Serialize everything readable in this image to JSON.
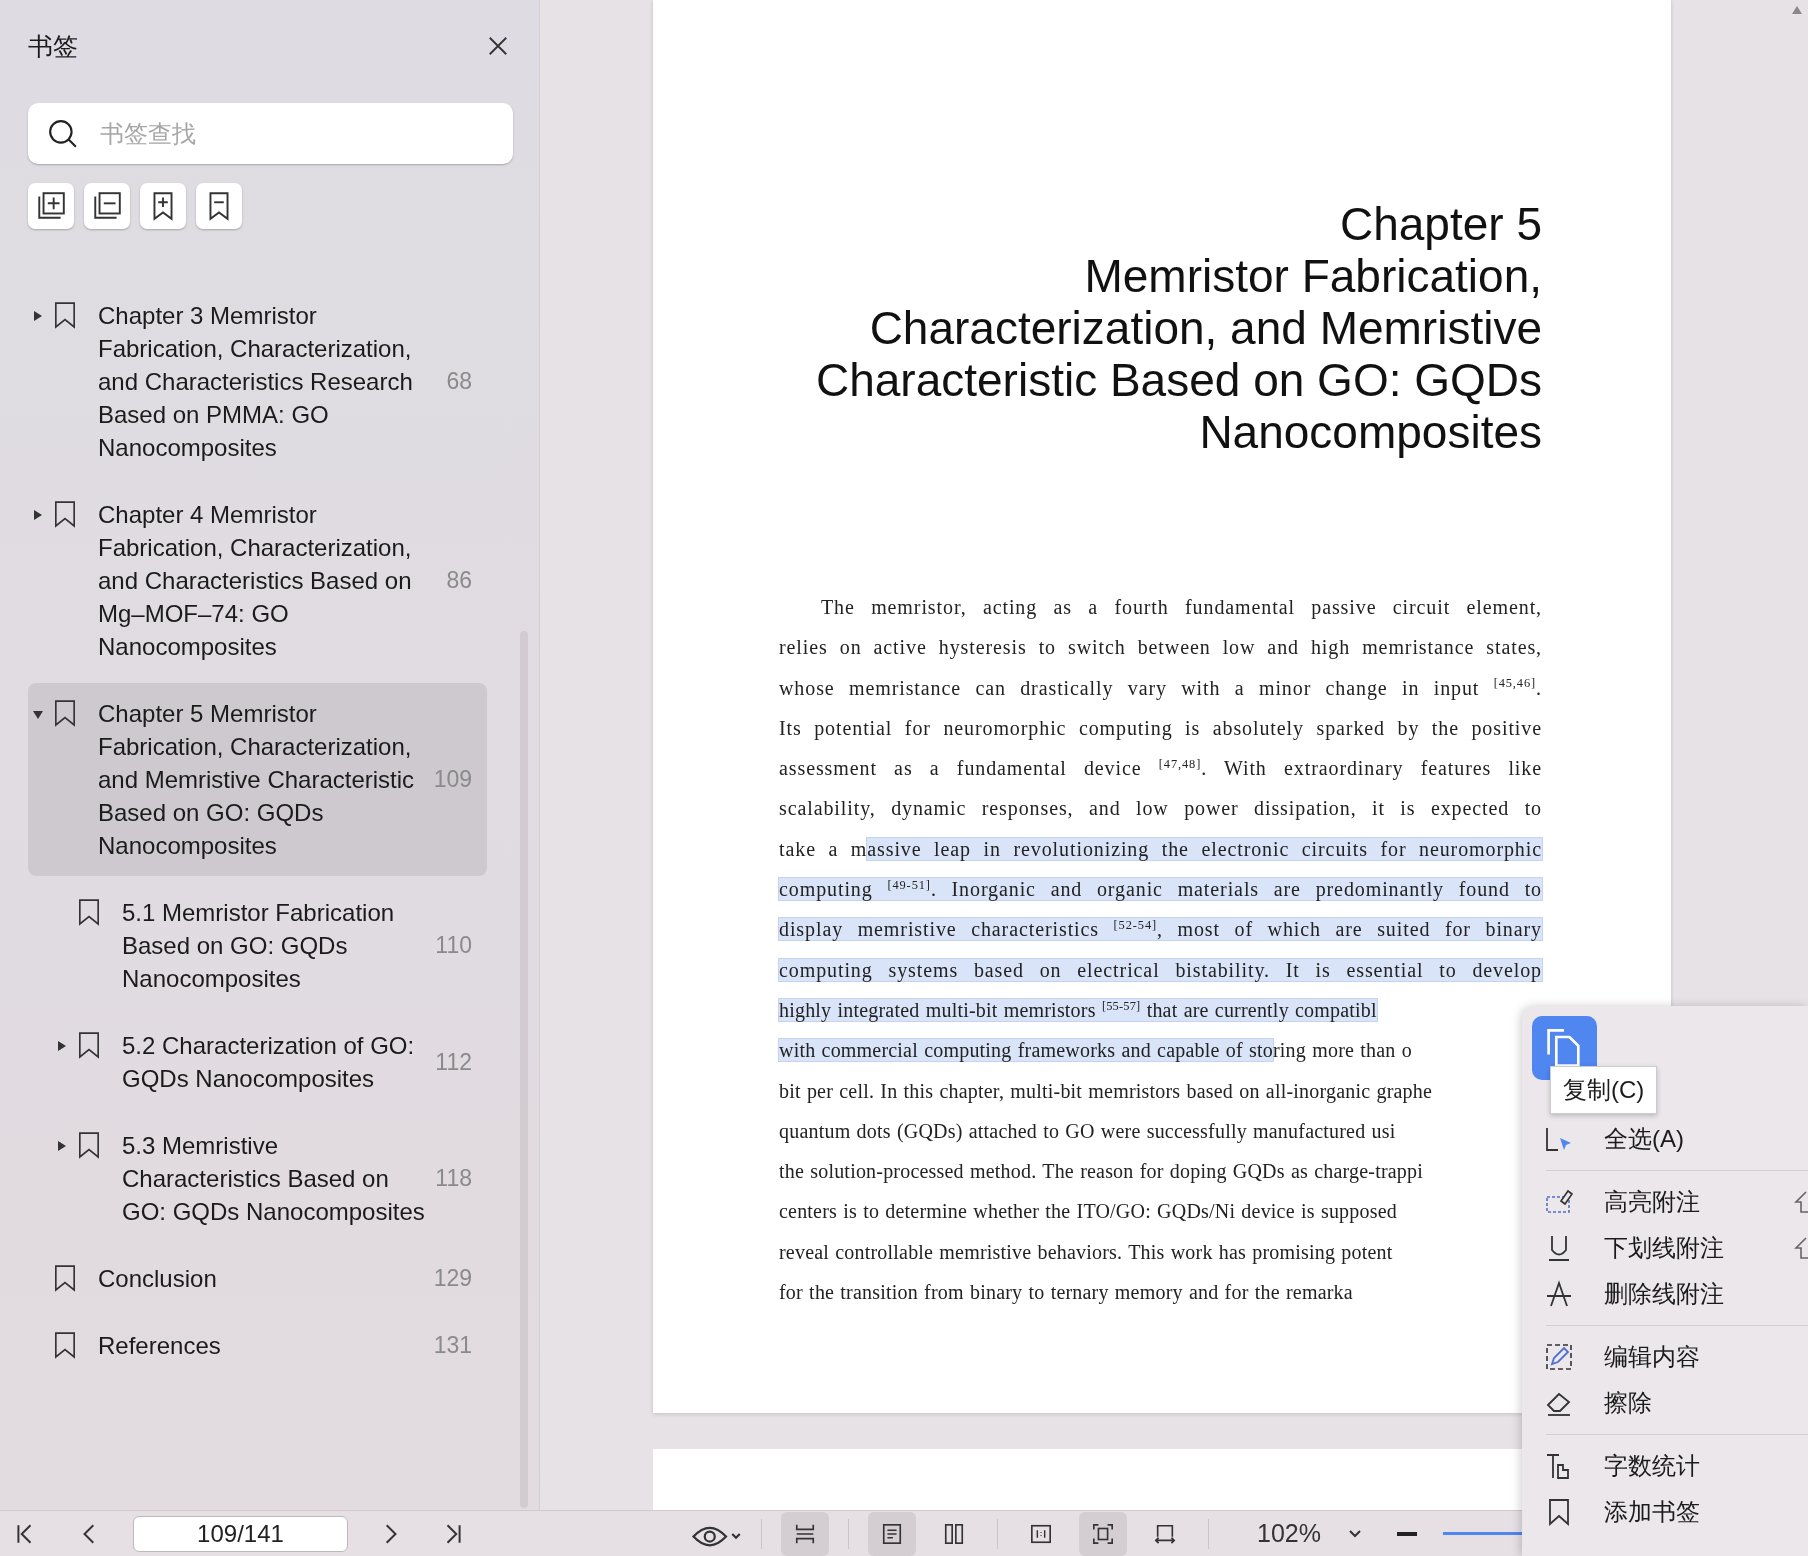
{
  "sidebar": {
    "title": "书签",
    "search": {
      "placeholder": "书签查找"
    },
    "bookmarks": [
      {
        "title": "Chapter 3 Memristor Fabrication, Characterization, and Characteristics Research Based on PMMA: GO Nanocomposites",
        "page": "68",
        "kind": "branch",
        "expanded": false,
        "selected": false
      },
      {
        "title": "Chapter 4 Memristor Fabrication, Characterization, and Characteristics Based on Mg–MOF–74: GO Nanocomposites",
        "page": "86",
        "kind": "branch",
        "expanded": false,
        "selected": false
      },
      {
        "title": "Chapter 5 Memristor Fabrication, Characterization, and Memristive Characteristic Based on GO: GQDs Nanocomposites",
        "page": "109",
        "kind": "branch",
        "expanded": true,
        "selected": true,
        "children": [
          {
            "title": "5.1 Memristor Fabrication Based on GO: GQDs Nanocomposites",
            "page": "110",
            "kind": "leaf",
            "selected": false
          },
          {
            "title": "5.2 Characterization of GO: GQDs Nanocomposites",
            "page": "112",
            "kind": "branch",
            "expanded": false,
            "selected": false
          },
          {
            "title": "5.3 Memristive Characteristics Based on GO: GQDs Nanocomposites",
            "page": "118",
            "kind": "branch",
            "expanded": false,
            "selected": false
          }
        ]
      },
      {
        "title": "Conclusion",
        "page": "129",
        "kind": "leaf",
        "selected": false
      },
      {
        "title": "References",
        "page": "131",
        "kind": "leaf",
        "selected": false
      }
    ]
  },
  "page": {
    "chapter_title": [
      "Chapter 5",
      "Memristor Fabrication,",
      "Characterization, and Memristive",
      "Characteristic Based on GO: GQDs",
      "Nanocomposites"
    ],
    "body_lines": [
      {
        "cut": false,
        "segments": [
          {
            "text": "The memristor, acting as a fourth fundamental passive circuit element,",
            "highlighted": false
          }
        ]
      },
      {
        "cut": false,
        "segments": [
          {
            "text": "relies on active hysteresis to switch between low and high memristance states,",
            "highlighted": false
          }
        ]
      },
      {
        "cut": false,
        "segments": [
          {
            "text": "whose memristance can drastically vary with a minor change in input $^{[45,46]}$.",
            "highlighted": false
          }
        ]
      },
      {
        "cut": false,
        "segments": [
          {
            "text": "Its potential for neuromorphic computing is absolutely sparked by the positive",
            "highlighted": false
          }
        ]
      },
      {
        "cut": false,
        "segments": [
          {
            "text": "assessment as a fundamental device $^{[47,48]}$. With extraordinary features like",
            "highlighted": false
          }
        ]
      },
      {
        "cut": false,
        "segments": [
          {
            "text": "scalability, dynamic responses, and low power dissipation, it is expected to",
            "highlighted": false
          }
        ]
      },
      {
        "cut": false,
        "segments": [
          {
            "text": "take a m",
            "highlighted": false
          },
          {
            "text": "assive leap in revolutionizing the electronic circuits for neuromorphic",
            "highlighted": true
          }
        ]
      },
      {
        "cut": false,
        "segments": [
          {
            "text": "computing $^{[49-51]}$. Inorganic and organic materials are predominantly found to",
            "highlighted": true
          }
        ]
      },
      {
        "cut": false,
        "segments": [
          {
            "text": "display memristive characteristics $^{[52-54]}$, most of which are suited for binary",
            "highlighted": true
          }
        ]
      },
      {
        "cut": false,
        "segments": [
          {
            "text": "computing systems based on electrical bistability. It is essential to develop",
            "highlighted": true
          }
        ]
      },
      {
        "cut": true,
        "segments": [
          {
            "text": "highly integrated multi-bit memristors $^{[55-57]}$ that are currently compatibl",
            "highlighted": true
          }
        ]
      },
      {
        "cut": true,
        "segments": [
          {
            "text": "with commercial computing frameworks and capable of sto",
            "highlighted": true
          },
          {
            "text": "ring more than o",
            "highlighted": false
          }
        ]
      },
      {
        "cut": true,
        "segments": [
          {
            "text": "bit per cell. In this chapter, multi-bit memristors based on all-inorganic graphe",
            "highlighted": false
          }
        ]
      },
      {
        "cut": true,
        "segments": [
          {
            "text": "quantum dots (GQDs) attached to GO were successfully manufactured usi",
            "highlighted": false
          }
        ]
      },
      {
        "cut": true,
        "segments": [
          {
            "text": "the solution-processed method. The reason for doping GQDs as charge-trappi",
            "highlighted": false
          }
        ]
      },
      {
        "cut": true,
        "segments": [
          {
            "text": "centers is to determine whether the ITO/GO: GQDs/Ni device is supposed",
            "highlighted": false
          }
        ]
      },
      {
        "cut": true,
        "segments": [
          {
            "text": "reveal controllable memristive behaviors. This work has promising potent",
            "highlighted": false
          }
        ]
      },
      {
        "cut": true,
        "segments": [
          {
            "text": "for the transition from binary to ternary memory and for the remarka",
            "highlighted": false
          }
        ]
      }
    ]
  },
  "toolbar": {
    "page_field": {
      "value": "109/141"
    },
    "view_buttons": [
      {
        "selected": true
      },
      {
        "selected": true
      },
      {
        "selected": false
      },
      {
        "selected": false
      },
      {
        "selected": true
      },
      {
        "selected": false
      }
    ],
    "zoom": "102%"
  },
  "context_menu": {
    "tooltip": "复制(C)",
    "groups": [
      [
        {
          "label": "全选(A)",
          "kind": "select-all"
        }
      ],
      [
        {
          "label": "高亮附注",
          "kind": "highlight"
        },
        {
          "label": "下划线附注",
          "kind": "underline"
        },
        {
          "label": "删除线附注",
          "kind": "strikethrough"
        }
      ],
      [
        {
          "label": "编辑内容",
          "kind": "edit"
        },
        {
          "label": "擦除",
          "kind": "erase"
        }
      ],
      [
        {
          "label": "字数统计",
          "kind": "word-count"
        },
        {
          "label": "添加书签",
          "kind": "add-bookmark"
        }
      ]
    ]
  }
}
